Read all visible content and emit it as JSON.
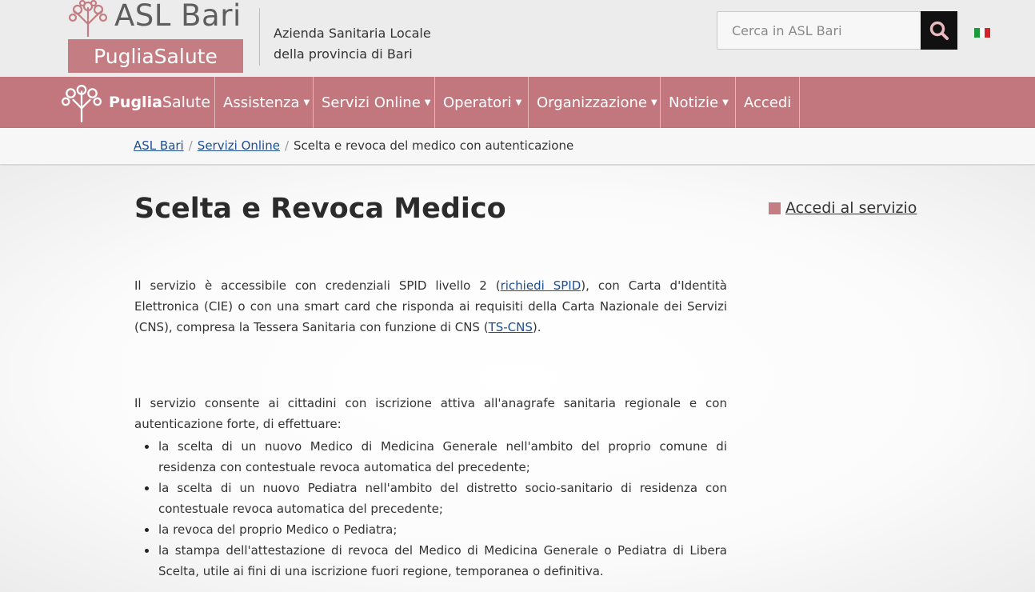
{
  "header": {
    "logo_title": "ASL Bari",
    "logo_subtitle": "PugliaSalute",
    "tagline_line1": "Azienda Sanitaria Locale",
    "tagline_line2": "della provincia di Bari",
    "search_placeholder": "Cerca in ASL Bari",
    "search_icon": "search-icon",
    "language_flag": "italian-flag-icon"
  },
  "navbar": {
    "brand_bold": "Puglia",
    "brand_light": "Salute",
    "items": [
      {
        "label": "Assistenza",
        "dropdown": true
      },
      {
        "label": "Servizi Online",
        "dropdown": true
      },
      {
        "label": "Operatori",
        "dropdown": true
      },
      {
        "label": "Organizzazione",
        "dropdown": true
      },
      {
        "label": "Notizie",
        "dropdown": true
      },
      {
        "label": "Accedi",
        "dropdown": false
      }
    ]
  },
  "breadcrumb": {
    "items": [
      "ASL Bari",
      "Servizi Online",
      "Scelta e revoca del medico con autenticazione"
    ]
  },
  "main": {
    "title": "Scelta e Revoca Medico",
    "service_link": "Accedi al servizio",
    "p1_a": "Il servizio è accessibile con credenziali SPID livello 2 (",
    "p1_link1": "richiedi SPID",
    "p1_b": "),  con Carta d'Identità Elettronica (CIE) o con una smart card che risponda ai requisiti della Carta Nazionale dei Servizi (CNS), compresa la Tessera Sanitaria con funzione di CNS (",
    "p1_link2": "TS-CNS",
    "p1_c": ").",
    "p2": "Il servizio consente ai cittadini con iscrizione attiva all'anagrafe sanitaria regionale e con autenticazione forte, di effettuare:",
    "bullets": [
      "la scelta di un nuovo Medico di Medicina Generale nell'ambito del proprio comune di residenza con contestuale revoca automatica del precedente;",
      "la scelta di un nuovo Pediatra nell'ambito del distretto socio-sanitario di residenza con contestuale revoca automatica del precedente;",
      "la revoca del proprio Medico o Pediatra;",
      "la stampa dell'attestazione di revoca del Medico di Medicina Generale o Pediatra di Libera Scelta, utile ai fini di una iscrizione fuori regione, temporanea o definitiva."
    ]
  },
  "colors": {
    "brand": "#c1777d",
    "link": "#1d4f91",
    "search_button": "#111111"
  }
}
